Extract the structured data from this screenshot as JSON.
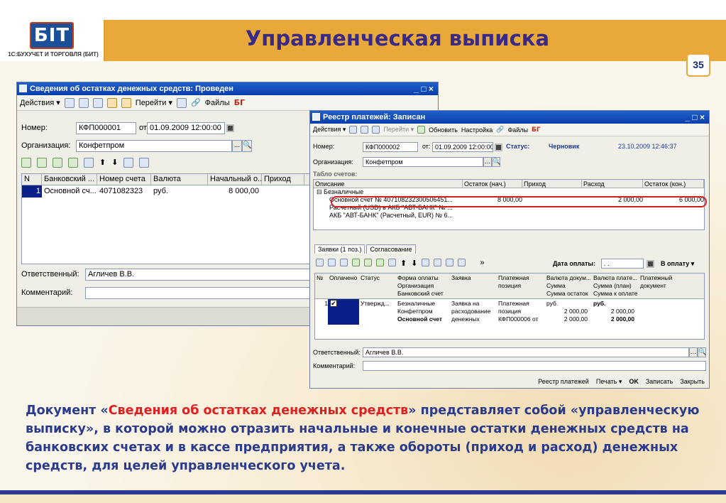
{
  "slide": {
    "title": "Управленческая выписка",
    "logo_mark": "БІТ",
    "logo_text": "1С:БУХУЧЕТ И ТОРГОВЛЯ (БИТ)",
    "page_number": "35",
    "description_pre": "Документ «",
    "description_highlight": "Сведения об остатках денежных средств",
    "description_post": "» представляет собой «управленческую выписку», в которой можно отразить начальные и конечные остатки денежных средств на банковских счетах и в кассе предприятия, а также обороты (приход и расход) денежных средств, для целей управленческого учета."
  },
  "window1": {
    "title": "Сведения об остатках денежных средств: Проведен",
    "controls": "_ □ ×",
    "toolbar": {
      "actions": "Действия ▾",
      "goto": "Перейти ▾",
      "files": "Файлы",
      "bit": "БГ"
    },
    "number_label": "Номер:",
    "number_value": "КФП000001",
    "from_label": "от",
    "date_value": "01.09.2009 12:00:00",
    "org_label": "Организация:",
    "org_value": "Конфетпром",
    "dots": "...",
    "columns": [
      "N",
      "Банковский ...",
      "Номер счета",
      "Валюта",
      "Начальный о...",
      "Приход"
    ],
    "rows": [
      [
        "1",
        "Основной сч...",
        "4071082323",
        "руб.",
        "8 000,00",
        ""
      ]
    ],
    "responsible_label": "Ответственный:",
    "responsible_value": "Агличев В.В.",
    "comment_label": "Комментарий:",
    "comment_value": ""
  },
  "window2": {
    "title": "Реестр платежей: Записан",
    "controls": "_ □ ×",
    "toolbar": {
      "actions": "Действия ▾",
      "goto": "Перейти ▾",
      "refresh": "Обновить",
      "settings": "Настройка",
      "files": "Файлы",
      "bit": "БГ"
    },
    "number_label": "Номер:",
    "number_value": "КФП000002",
    "from_label": "от:",
    "date_value": "01.09.2009 12:00:00",
    "status_label": "Статус:",
    "status_value": "Черновик",
    "timestamp": "23.10.2009 12:46:37",
    "org_label": "Организация:",
    "org_value": "Конфетпром",
    "accounts_section": "Табло счетов:",
    "tree_columns": [
      "Описание",
      "Остаток (нач.)",
      "Приход",
      "Расход",
      "Остаток (кон.)"
    ],
    "tree_group": "⊟ Безналичные",
    "tree_rows": [
      {
        "desc": "Основной счет № 407108232300506451...",
        "start": "8 000,00",
        "in": "",
        "out": "2 000,00",
        "end": "6 000,00"
      },
      {
        "desc": "Расчетный (USD) в АКБ \"АВТ-БАНК\" № ...",
        "start": "",
        "in": "",
        "out": "",
        "end": ""
      },
      {
        "desc": "АКБ \"АВТ-БАНК\" (Расчетный, EUR) № 6...",
        "start": "",
        "in": "",
        "out": "",
        "end": ""
      }
    ],
    "tabs": [
      "Заявки (1 поз.)",
      "Согласование"
    ],
    "pay_date_label": "Дата оплаты:",
    "pay_date_value": ". .",
    "to_payment": "В оплату ▾",
    "grid_headers": {
      "n": "№",
      "paid": "Оплачено",
      "status": "Статус",
      "form": [
        "Форма оплаты",
        "Организация",
        "Банковский счет"
      ],
      "request": "Заявка",
      "position": [
        "Платежная",
        "позиция"
      ],
      "doc_currency": [
        "Валюта докум...",
        "Сумма",
        "Сумма остаток"
      ],
      "pay_currency": [
        "Валюта плате...",
        "Сумма (план)",
        "Сумма к оплате"
      ],
      "pay_doc": [
        "Платежный",
        "документ"
      ]
    },
    "grid_row": {
      "n": "1",
      "check": "✔",
      "status": "Утвержд...",
      "form": [
        "Безналичные",
        "Конфетпром",
        "Основной счет"
      ],
      "request": [
        "Заявка на",
        "расходование",
        "денежных"
      ],
      "position": [
        "Платежная",
        "позиция",
        "КФП000006 от"
      ],
      "doc_currency": [
        "руб.",
        "2 000,00",
        "2 000,00"
      ],
      "pay_currency": [
        "руб.",
        "2 000,00",
        "2 000,00"
      ]
    },
    "responsible_label": "Ответственный:",
    "responsible_value": "Агличев В.В.",
    "comment_label": "Комментарий:",
    "comment_value": "",
    "bottom_buttons": [
      "Реестр платежей",
      "Печать ▾",
      "OK",
      "Записать",
      "Закрыть"
    ]
  }
}
